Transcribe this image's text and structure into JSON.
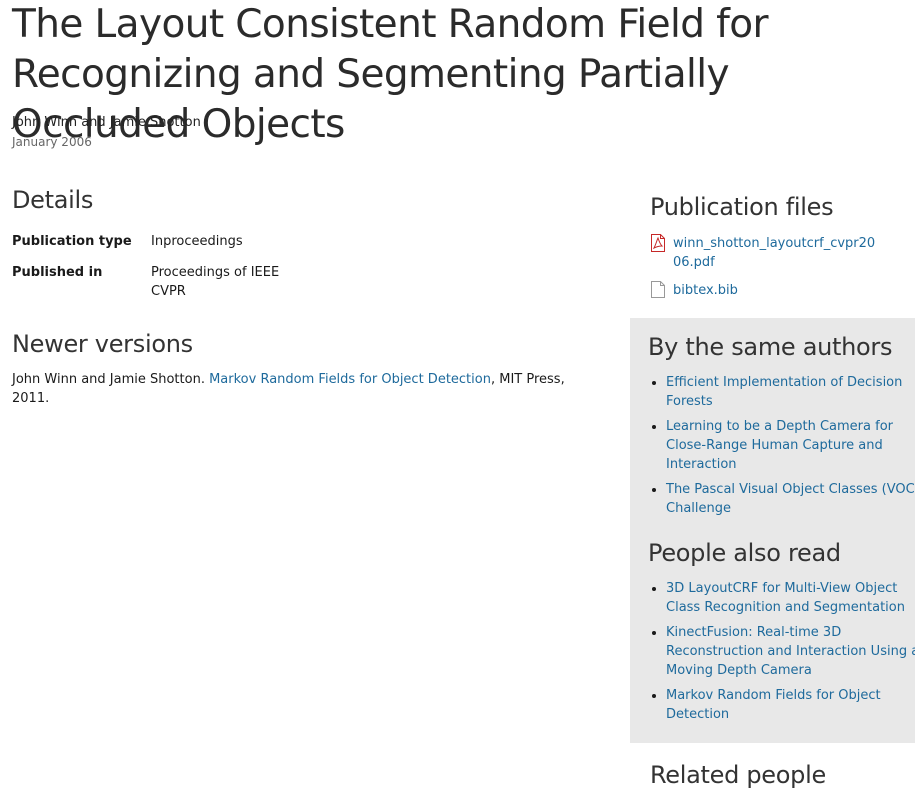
{
  "publication": {
    "title": "The Layout Consistent Random Field for Recognizing and Segmenting Partially Occluded Objects",
    "authors": "John Winn and Jamie Shotton",
    "date": "January 2006"
  },
  "details": {
    "heading": "Details",
    "rows": [
      {
        "label": "Publication type",
        "value": "Inproceedings"
      },
      {
        "label": "Published in",
        "value": "Proceedings of IEEE CVPR"
      }
    ]
  },
  "newer_versions": {
    "heading": "Newer versions",
    "authors_prefix": "John Winn and Jamie Shotton. ",
    "link": "Markov Random Fields for Object Detection",
    "suffix": ", MIT Press, 2011."
  },
  "publication_files": {
    "heading": "Publication files",
    "files": [
      {
        "name": "winn_shotton_layoutcrf_cvpr2006.pdf",
        "icon": "pdf-file-icon"
      },
      {
        "name": "bibtex.bib",
        "icon": "document-file-icon"
      }
    ]
  },
  "same_authors": {
    "heading": "By the same authors",
    "items": [
      "Efficient Implementation of Decision Forests",
      "Learning to be a Depth Camera for Close-Range Human Capture and Interaction",
      "The Pascal Visual Object Classes (VOC) Challenge"
    ]
  },
  "people_also_read": {
    "heading": "People also read",
    "items": [
      "3D LayoutCRF for Multi-View Object Class Recognition and Segmentation",
      "KinectFusion: Real-time 3D Reconstruction and Interaction Using a Moving Depth Camera",
      "Markov Random Fields for Object Detection"
    ]
  },
  "related_people": {
    "heading": "Related people"
  },
  "colors": {
    "link": "#1e6a9c",
    "sidebar_background": "#e8e8e8",
    "pdf_icon": "#c62828"
  }
}
